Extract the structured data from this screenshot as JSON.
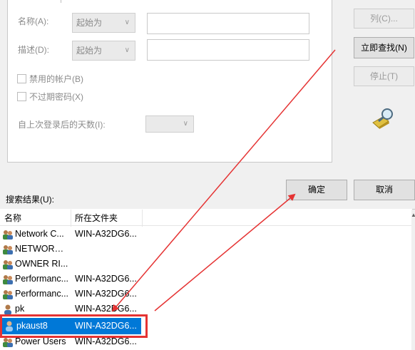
{
  "query_panel": {
    "name_label": "名称(A):",
    "name_mode": "起始为",
    "name_value": "",
    "desc_label": "描述(D):",
    "desc_mode": "起始为",
    "desc_value": "",
    "disabled_accounts_label": "禁用的帐户(B)",
    "no_expire_password_label": "不过期密码(X)",
    "days_since_logon_label": "自上次登录后的天数(I):",
    "days_since_logon_value": ""
  },
  "side_buttons": {
    "columns": "列(C)...",
    "find_now": "立即查找(N)",
    "stop": "停止(T)"
  },
  "dialog_buttons": {
    "ok": "确定",
    "cancel": "取消"
  },
  "results": {
    "label": "搜索结果(U):",
    "columns": [
      "名称",
      "所在文件夹"
    ],
    "rows": [
      {
        "name": "Network C...",
        "folder": "WIN-A32DG6...",
        "icon": "group-icon"
      },
      {
        "name": "NETWORK ...",
        "folder": "",
        "icon": "group-icon"
      },
      {
        "name": "OWNER RI...",
        "folder": "",
        "icon": "group-icon"
      },
      {
        "name": "Performanc...",
        "folder": "WIN-A32DG6...",
        "icon": "group-icon"
      },
      {
        "name": "Performanc...",
        "folder": "WIN-A32DG6...",
        "icon": "group-icon"
      },
      {
        "name": "pk",
        "folder": "WIN-A32DG6...",
        "icon": "user-icon"
      },
      {
        "name": "pkaust8",
        "folder": "WIN-A32DG6...",
        "icon": "user-icon",
        "selected": true
      },
      {
        "name": "Power Users",
        "folder": "WIN-A32DG6...",
        "icon": "group-icon"
      }
    ]
  },
  "colors": {
    "selection": "#0078d7",
    "annotation_red": "#e53333",
    "panel_bg": "#ffffff",
    "window_bg": "#f0f0f0"
  }
}
